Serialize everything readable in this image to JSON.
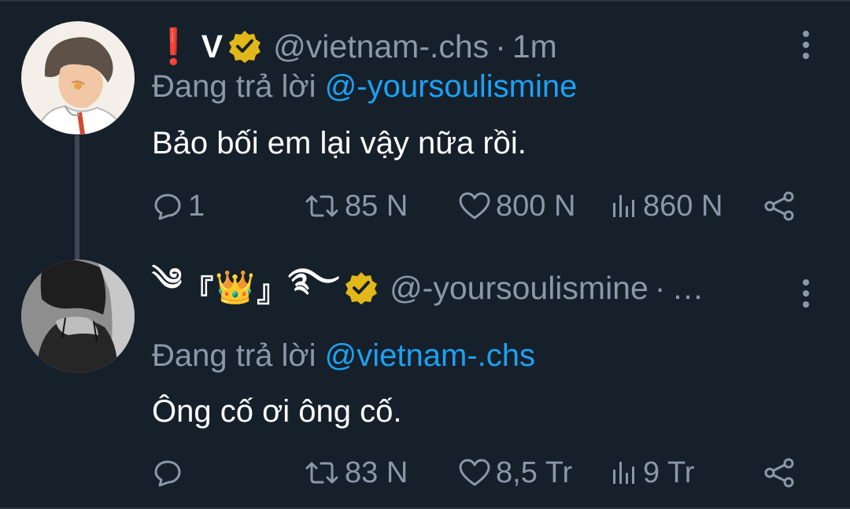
{
  "tweets": [
    {
      "prefix_emoji": "❗",
      "display_name": "V",
      "verified": true,
      "handle": "@vietnam-.chs",
      "separator": "·",
      "time": "1m",
      "replying_label": "Đang trả lời",
      "replying_to": "@-yoursoulismine",
      "text": "Bảo bối em lại vậy nữa rồi.",
      "reply_count": "1",
      "retweet_count": "85 N",
      "like_count": "800 N",
      "view_count": "860 N"
    },
    {
      "name_left_glyph": "༄",
      "name_open_bracket": "『",
      "name_emoji": "👑",
      "name_close_bracket": "』",
      "name_right_glyph": "࿐",
      "verified": true,
      "handle": "@-yoursoulismine",
      "separator": "·",
      "truncation": "…",
      "replying_label": "Đang trả lời",
      "replying_to": "@vietnam-.chs",
      "text": "Ông cố ơi ông cố.",
      "reply_count": "",
      "retweet_count": "83 N",
      "like_count": "8,5 Tr",
      "view_count": "9 Tr"
    }
  ],
  "icons": {
    "verified": "verified-badge-icon",
    "more": "more-vertical-icon",
    "reply": "reply-icon",
    "retweet": "retweet-icon",
    "like": "heart-icon",
    "views": "views-chart-icon",
    "share": "share-icon"
  },
  "colors": {
    "background": "#15202b",
    "text_primary": "#ffffff",
    "text_secondary": "#8b98a5",
    "link": "#1da1f2",
    "verified_gold": "#e2b719",
    "exclaim_red": "#e0245e"
  }
}
